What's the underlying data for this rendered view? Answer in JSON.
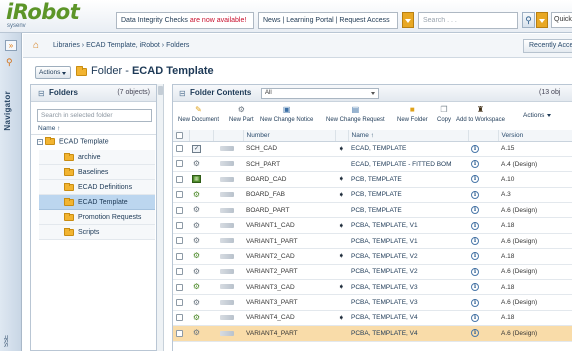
{
  "header": {
    "logo_text": "iRobot",
    "logo_sub": "sysenv",
    "notice1_text": "Data Integrity Checks ",
    "notice1_highlight": "are now available!",
    "notice2_text": "News | Learning Portal | Request Access",
    "search_placeholder": "Search . . .",
    "quick_label": "Quick"
  },
  "navigator": {
    "label": "Navigator",
    "bottom_label": "SSE"
  },
  "breadcrumb": {
    "path": "Libraries › ECAD Template, iRobot › Folders",
    "recently_accessed": "Recently Acce"
  },
  "page": {
    "actions_label": "Actions",
    "title_prefix": "Folder - ",
    "title_name": "ECAD Template"
  },
  "folders_panel": {
    "title": "Folders",
    "count": "(7 objects)",
    "search_placeholder": "Search in selected folder",
    "column_header": "Name ↑",
    "root": "ECAD Template",
    "items": [
      {
        "label": "archive"
      },
      {
        "label": "Baselines"
      },
      {
        "label": "ECAD Definitions"
      },
      {
        "label": "ECAD Template",
        "selected": true
      },
      {
        "label": "Promotion Requests"
      },
      {
        "label": "Scripts"
      }
    ]
  },
  "contents_panel": {
    "title": "Folder Contents",
    "view_value": "All",
    "count": "(13 obj",
    "toolbar": [
      {
        "label": "New Document",
        "icon": "new-document-icon"
      },
      {
        "label": "New Part",
        "icon": "new-part-icon"
      },
      {
        "label": "New Change Notice",
        "icon": "new-change-notice-icon"
      },
      {
        "label": "New Change Request",
        "icon": "new-change-request-icon"
      },
      {
        "label": "New Folder",
        "icon": "new-folder-icon"
      },
      {
        "label": "Copy",
        "icon": "copy-icon"
      },
      {
        "label": "Add to Workspace",
        "icon": "add-to-workspace-icon"
      }
    ],
    "actions_label": "Actions",
    "columns": {
      "number": "Number",
      "name": "Name ↑",
      "version": "Version"
    },
    "rows": [
      {
        "number": "SCH_CAD",
        "name": "ECAD, TEMPLATE",
        "version": "A.15",
        "type": "cad",
        "context": true
      },
      {
        "number": "SCH_PART",
        "name": "ECAD, TEMPLATE - FITTED BOM",
        "version": "A.4 (Design)",
        "type": "part",
        "context": false
      },
      {
        "number": "BOARD_CAD",
        "name": "PCB, TEMPLATE",
        "version": "A.10",
        "type": "pcb",
        "context": true
      },
      {
        "number": "BOARD_FAB",
        "name": "PCB, TEMPLATE",
        "version": "A.3",
        "type": "fab",
        "context": true
      },
      {
        "number": "BOARD_PART",
        "name": "PCB, TEMPLATE",
        "version": "A.6 (Design)",
        "type": "part",
        "context": false
      },
      {
        "number": "VARIANT1_CAD",
        "name": "PCBA, TEMPLATE, V1",
        "version": "A.18",
        "type": "part",
        "context": true
      },
      {
        "number": "VARIANT1_PART",
        "name": "PCBA, TEMPLATE, V1",
        "version": "A.6 (Design)",
        "type": "part",
        "context": false
      },
      {
        "number": "VARIANT2_CAD",
        "name": "PCBA, TEMPLATE, V2",
        "version": "A.18",
        "type": "fab",
        "context": true
      },
      {
        "number": "VARIANT2_PART",
        "name": "PCBA, TEMPLATE, V2",
        "version": "A.6 (Design)",
        "type": "part",
        "context": false
      },
      {
        "number": "VARIANT3_CAD",
        "name": "PCBA, TEMPLATE, V3",
        "version": "A.18",
        "type": "fab",
        "context": true
      },
      {
        "number": "VARIANT3_PART",
        "name": "PCBA, TEMPLATE, V3",
        "version": "A.6 (Design)",
        "type": "part",
        "context": false
      },
      {
        "number": "VARIANT4_CAD",
        "name": "PCBA, TEMPLATE, V4",
        "version": "A.18",
        "type": "fab",
        "context": true
      },
      {
        "number": "VARIANT4_PART",
        "name": "PCBA, TEMPLATE, V4",
        "version": "A.6 (Design)",
        "type": "part",
        "context": false,
        "selected": true
      }
    ]
  }
}
